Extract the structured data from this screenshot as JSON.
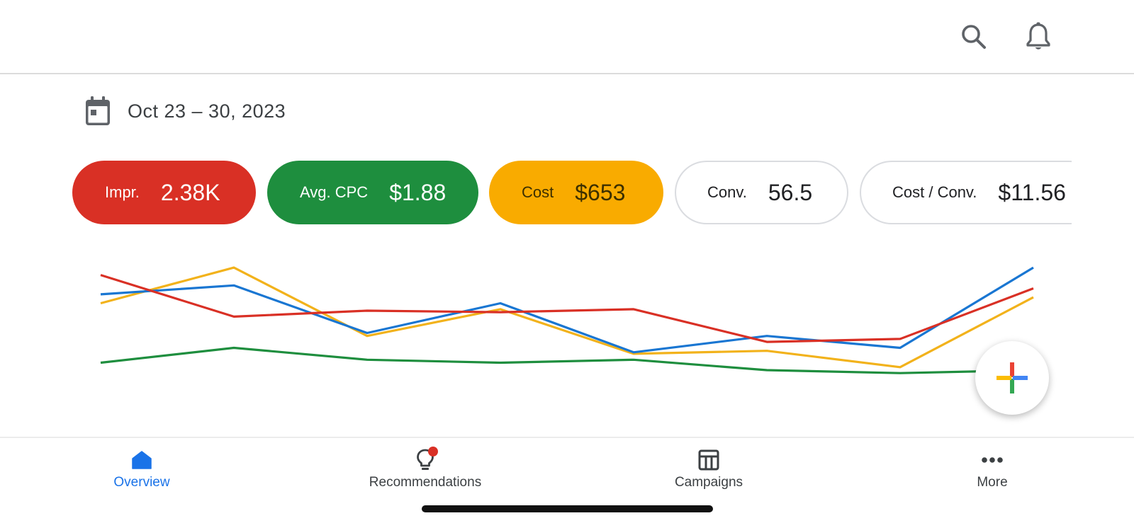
{
  "header": {
    "search_icon": "search-icon",
    "notifications_icon": "bell-icon"
  },
  "date_range": {
    "icon": "calendar-icon",
    "label": "Oct 23 – 30, 2023"
  },
  "metrics": [
    {
      "label": "Impr.",
      "value": "2.38K",
      "color": "#d93025",
      "selected": true
    },
    {
      "label": "Avg. CPC",
      "value": "$1.88",
      "color": "#1e8e3e",
      "selected": true
    },
    {
      "label": "Cost",
      "value": "$653",
      "color": "#f9ab00",
      "selected": true
    },
    {
      "label": "Conv.",
      "value": "56.5",
      "color": "#ffffff",
      "selected": false
    },
    {
      "label": "Cost / Conv.",
      "value": "$11.56",
      "color": "#ffffff",
      "selected": false
    }
  ],
  "chart_data": {
    "type": "line",
    "title": "",
    "xlabel": "",
    "ylabel": "",
    "ylim": [
      0,
      100
    ],
    "grid": false,
    "legend": "none",
    "x": [
      1,
      2,
      3,
      4,
      5,
      6,
      7,
      8
    ],
    "series": [
      {
        "color": "#d93025",
        "values": [
          84,
          56,
          60,
          59,
          61,
          39,
          41,
          75
        ]
      },
      {
        "color": "#1976d2",
        "values": [
          71,
          77,
          45,
          65,
          32,
          43,
          35,
          89
        ]
      },
      {
        "color": "#f2b21b",
        "values": [
          65,
          89,
          43,
          61,
          31,
          33,
          22,
          69
        ]
      },
      {
        "color": "#1e8e3e",
        "values": [
          25,
          35,
          27,
          25,
          27,
          20,
          18,
          20
        ]
      }
    ]
  },
  "fab": {
    "icon": "plus-icon"
  },
  "bottom_nav": {
    "items": [
      {
        "label": "Overview",
        "icon": "home-icon",
        "active": true
      },
      {
        "label": "Recommendations",
        "icon": "lightbulb-icon",
        "active": false
      },
      {
        "label": "Campaigns",
        "icon": "table-icon",
        "active": false
      },
      {
        "label": "More",
        "icon": "more-horizontal-icon",
        "active": false
      }
    ]
  },
  "colors": {
    "accent": "#1a73e8",
    "red": "#d93025",
    "green": "#1e8e3e",
    "yellow": "#f9ab00",
    "blue": "#1976d2"
  }
}
